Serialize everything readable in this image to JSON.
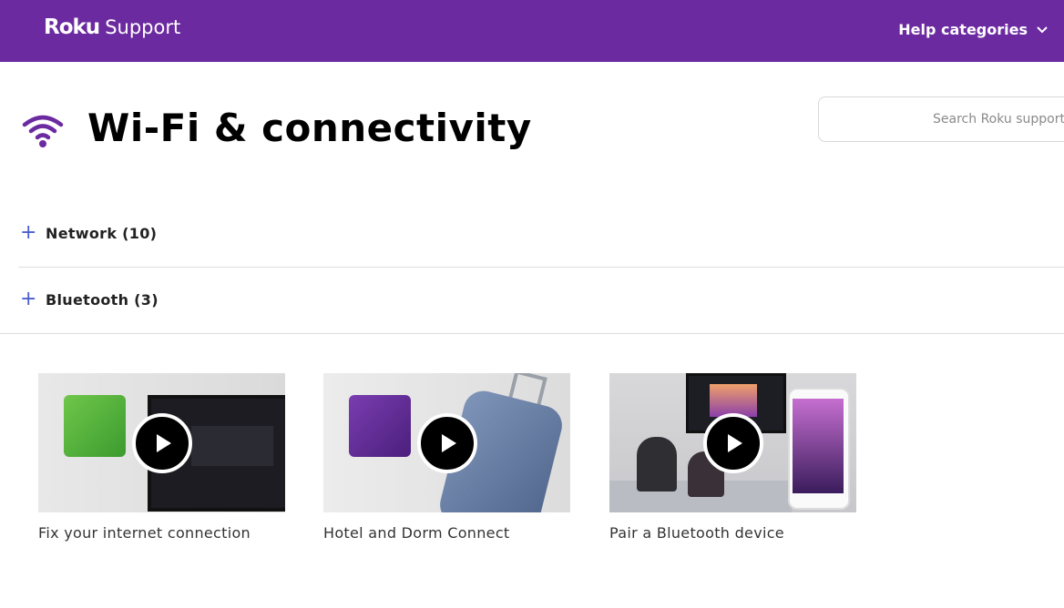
{
  "header": {
    "logo": "Roku",
    "subtitle": "Support",
    "help_categories": "Help categories"
  },
  "page": {
    "title": "Wi-Fi & connectivity",
    "icon": "wifi-icon"
  },
  "search": {
    "placeholder": "Search Roku support"
  },
  "accordion": [
    {
      "label": "Network (10)"
    },
    {
      "label": "Bluetooth (3)"
    }
  ],
  "videos": [
    {
      "title": "Fix your internet connection"
    },
    {
      "title": "Hotel and Dorm Connect"
    },
    {
      "title": "Pair a Bluetooth device"
    }
  ],
  "colors": {
    "brand_purple": "#6c2aa1",
    "accent_blue": "#4b5fd1"
  }
}
